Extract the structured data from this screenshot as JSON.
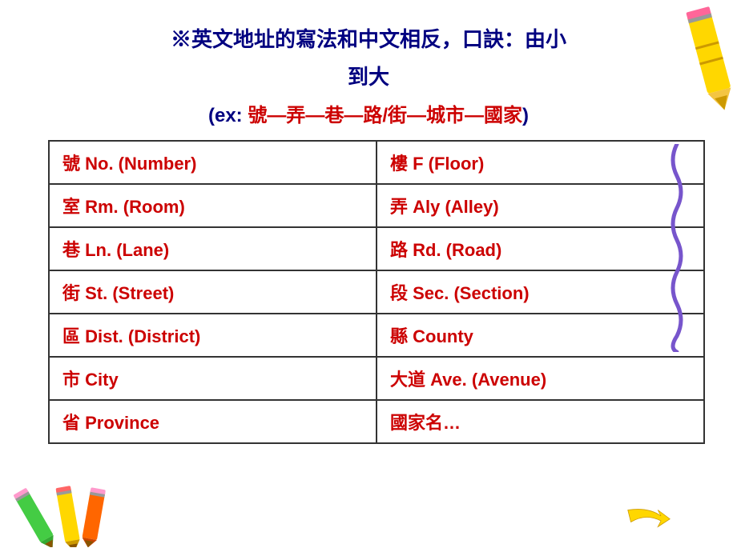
{
  "header": {
    "line1": "※英文地址的寫法和中文相反，口訣：由小",
    "line2": "到大",
    "line3_prefix": "(ex: 號—弄—巷—路/街—城市—國家)"
  },
  "table": {
    "rows": [
      {
        "left": "號 No. (Number)",
        "right": "樓 F (Floor)"
      },
      {
        "left": "室 Rm. (Room)",
        "right": "弄 Aly (Alley)"
      },
      {
        "left": "巷 Ln. (Lane)",
        "right": "路 Rd. (Road)"
      },
      {
        "left": "街 St. (Street)",
        "right": "段 Sec. (Section)"
      },
      {
        "left": "區 Dist. (District)",
        "right": "縣 County"
      },
      {
        "left": "市 City",
        "right": "大道 Ave. (Avenue)"
      },
      {
        "left": "省 Province",
        "right": "國家名…"
      }
    ]
  }
}
